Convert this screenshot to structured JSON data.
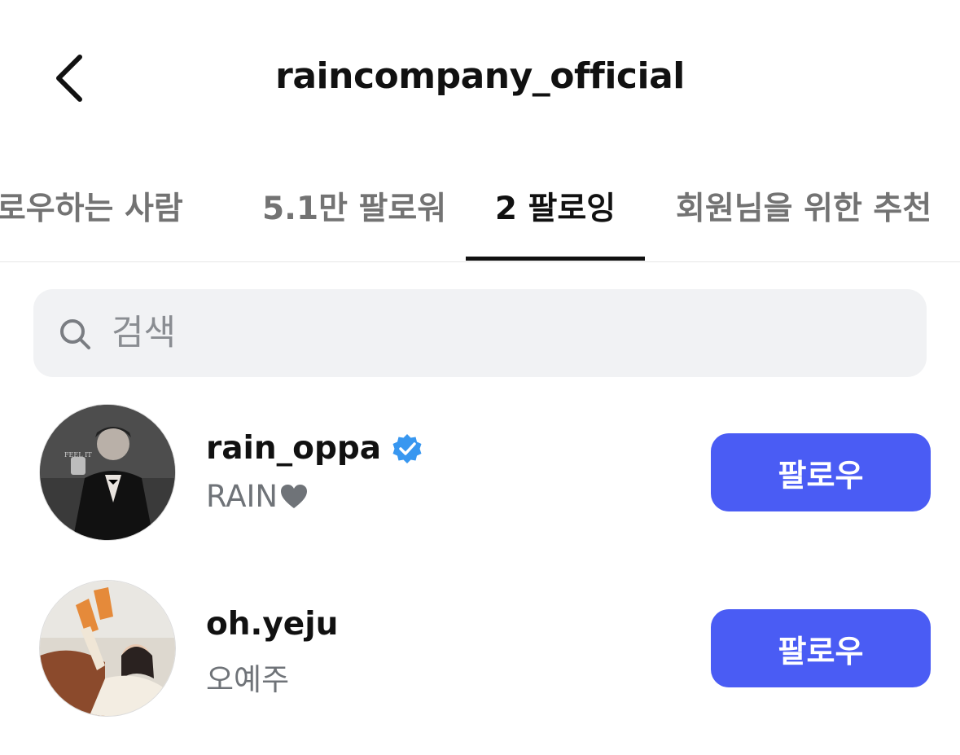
{
  "header": {
    "title": "raincompany_official"
  },
  "tabs": [
    {
      "label": "팔로우하는 사람",
      "active": false
    },
    {
      "label": "5.1만 팔로워",
      "active": false
    },
    {
      "label": "2 팔로잉",
      "active": true
    },
    {
      "label": "회원님을 위한 추천",
      "active": false
    }
  ],
  "search": {
    "placeholder": "검색"
  },
  "following": [
    {
      "username": "rain_oppa",
      "verified": true,
      "full_name": "RAIN",
      "full_name_icon": "heart-icon",
      "button_label": "팔로우"
    },
    {
      "username": "oh.yeju",
      "verified": false,
      "full_name": "오예주",
      "button_label": "팔로우"
    }
  ],
  "colors": {
    "accent": "#4a5cf4",
    "verified": "#3897f0",
    "muted_text": "#737373",
    "search_bg": "#f1f2f4"
  }
}
